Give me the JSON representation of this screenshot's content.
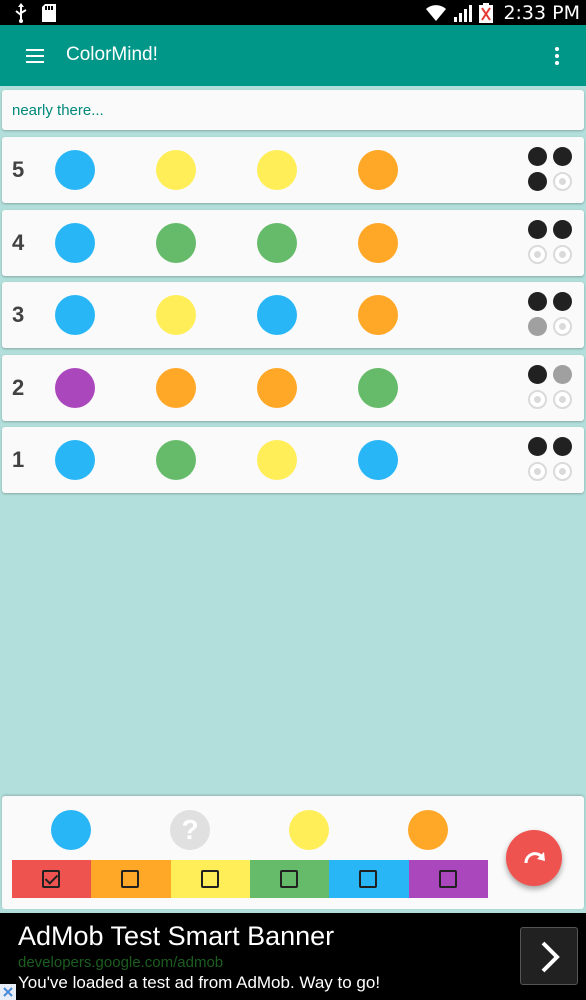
{
  "status_bar": {
    "time": "2:33 PM",
    "left_icons": [
      "usb-icon",
      "sd-card-icon"
    ],
    "right_icons": [
      "wifi-icon",
      "signal-icon",
      "battery-icon"
    ]
  },
  "app_bar": {
    "title": "ColorMind!",
    "menu_icon": "menu-icon",
    "more_icon": "more-vert-icon"
  },
  "message": "nearly there...",
  "colors": {
    "red": "#ef5350",
    "orange": "#ffa726",
    "yellow": "#ffee58",
    "green": "#66bb6a",
    "blue": "#29b6f6",
    "purple": "#ab47bc",
    "primary": "#009688",
    "background": "#b2dfdb"
  },
  "guesses": [
    {
      "number": "5",
      "pegs": [
        "blue",
        "yellow",
        "yellow",
        "orange"
      ],
      "feedback": [
        "black",
        "black",
        "black",
        "empty"
      ]
    },
    {
      "number": "4",
      "pegs": [
        "blue",
        "green",
        "green",
        "orange"
      ],
      "feedback": [
        "black",
        "black",
        "empty",
        "empty"
      ]
    },
    {
      "number": "3",
      "pegs": [
        "blue",
        "yellow",
        "blue",
        "orange"
      ],
      "feedback": [
        "black",
        "black",
        "white",
        "empty"
      ]
    },
    {
      "number": "2",
      "pegs": [
        "purple",
        "orange",
        "orange",
        "green"
      ],
      "feedback": [
        "black",
        "white",
        "empty",
        "empty"
      ]
    },
    {
      "number": "1",
      "pegs": [
        "blue",
        "green",
        "yellow",
        "blue"
      ],
      "feedback": [
        "black",
        "black",
        "empty",
        "empty"
      ]
    }
  ],
  "current_guess": [
    "blue",
    "unknown",
    "yellow",
    "orange"
  ],
  "unknown_symbol": "?",
  "palette": [
    {
      "color": "red",
      "checked": true
    },
    {
      "color": "orange",
      "checked": false
    },
    {
      "color": "yellow",
      "checked": false
    },
    {
      "color": "green",
      "checked": false
    },
    {
      "color": "blue",
      "checked": false
    },
    {
      "color": "purple",
      "checked": false
    }
  ],
  "fab_icon": "redo-icon",
  "ad": {
    "title": "AdMob Test Smart Banner",
    "url": "developers.google.com/admob",
    "text": "You've loaded a test ad from AdMob. Way to go!",
    "arrow_icon": "chevron-right-icon",
    "close_icon": "close-icon"
  }
}
